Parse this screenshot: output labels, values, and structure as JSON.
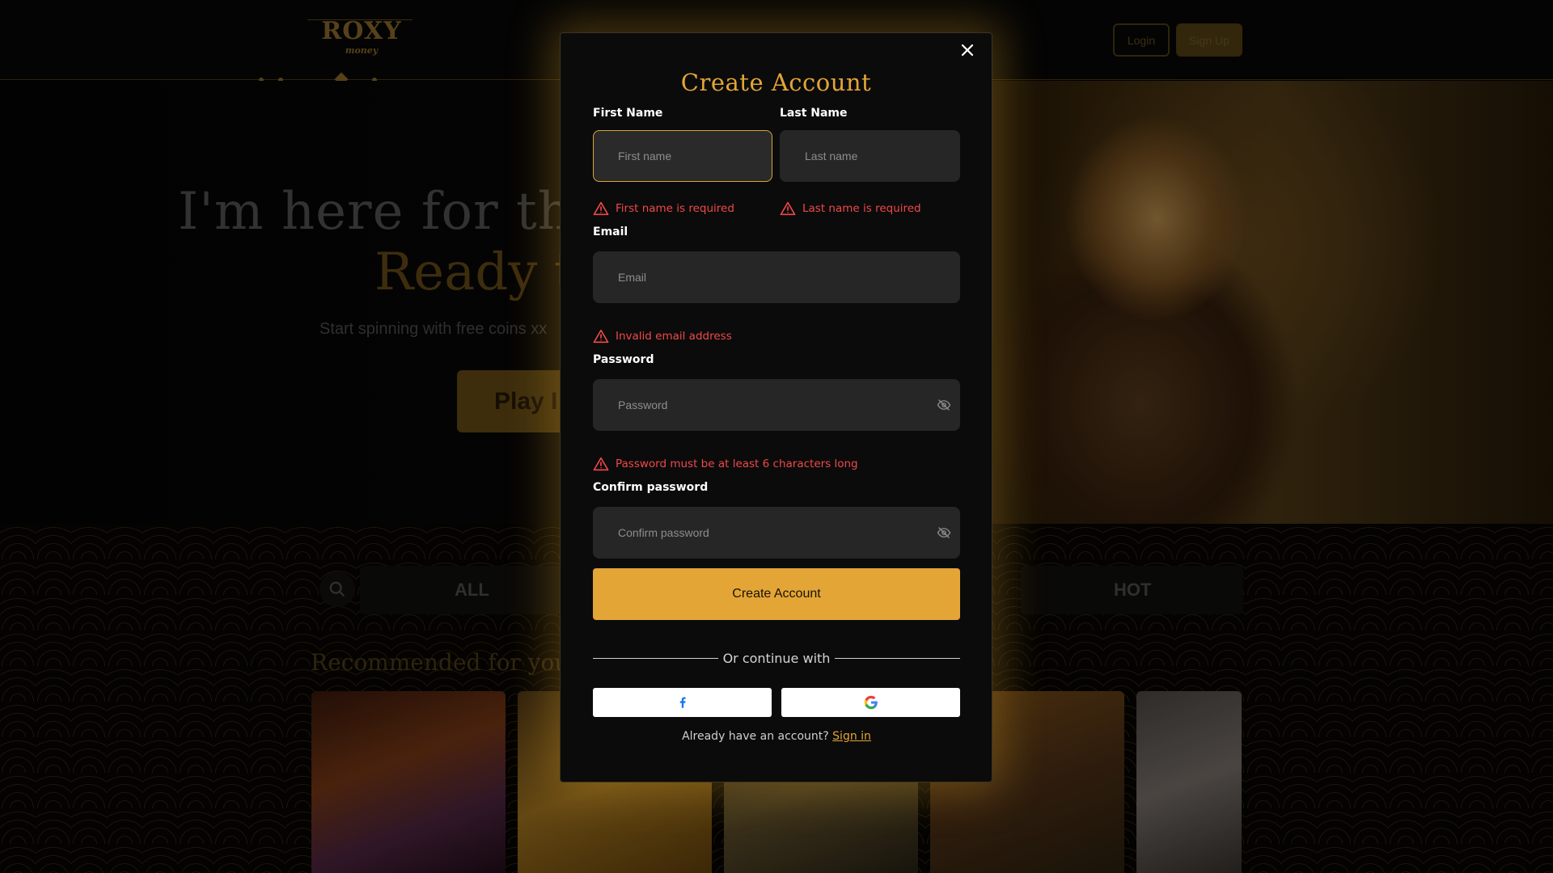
{
  "background": {
    "logo": {
      "name": "ROXY",
      "tagline": "money"
    },
    "nav": {
      "login_label": "Login",
      "signup_label": "Sign Up"
    },
    "hero": {
      "headline": "I'm here for the",
      "headline_accent": "Ready t",
      "subtitle": "Start spinning with free coins xx",
      "play_label": "Play I"
    },
    "filters": {
      "all_label": "ALL",
      "hot_label": "HOT"
    },
    "recommended_title": "Recommended for you"
  },
  "modal": {
    "title": "Create Account",
    "first_name": {
      "label": "First Name",
      "placeholder": "First name",
      "error": "First name is required"
    },
    "last_name": {
      "label": "Last Name",
      "placeholder": "Last name",
      "error": "Last name is required"
    },
    "email": {
      "label": "Email",
      "placeholder": "Email",
      "error": "Invalid email address"
    },
    "password": {
      "label": "Password",
      "placeholder": "Password",
      "error": "Password must be at least 6 characters long"
    },
    "confirm_password": {
      "label": "Confirm password",
      "placeholder": "Confirm password"
    },
    "submit_label": "Create Account",
    "divider_text": "Or continue with",
    "footer": {
      "text": "Already have an account?",
      "link": "Sign in"
    }
  },
  "colors": {
    "accent": "#e3a536",
    "error": "#f0484a",
    "modal_bg": "#0b0b0b",
    "input_bg": "#262626"
  },
  "icons": {
    "close": "close-icon",
    "error": "warning-triangle-icon",
    "password_toggle": "eye-off-icon",
    "facebook": "facebook-icon",
    "google": "google-icon",
    "search": "search-icon"
  }
}
